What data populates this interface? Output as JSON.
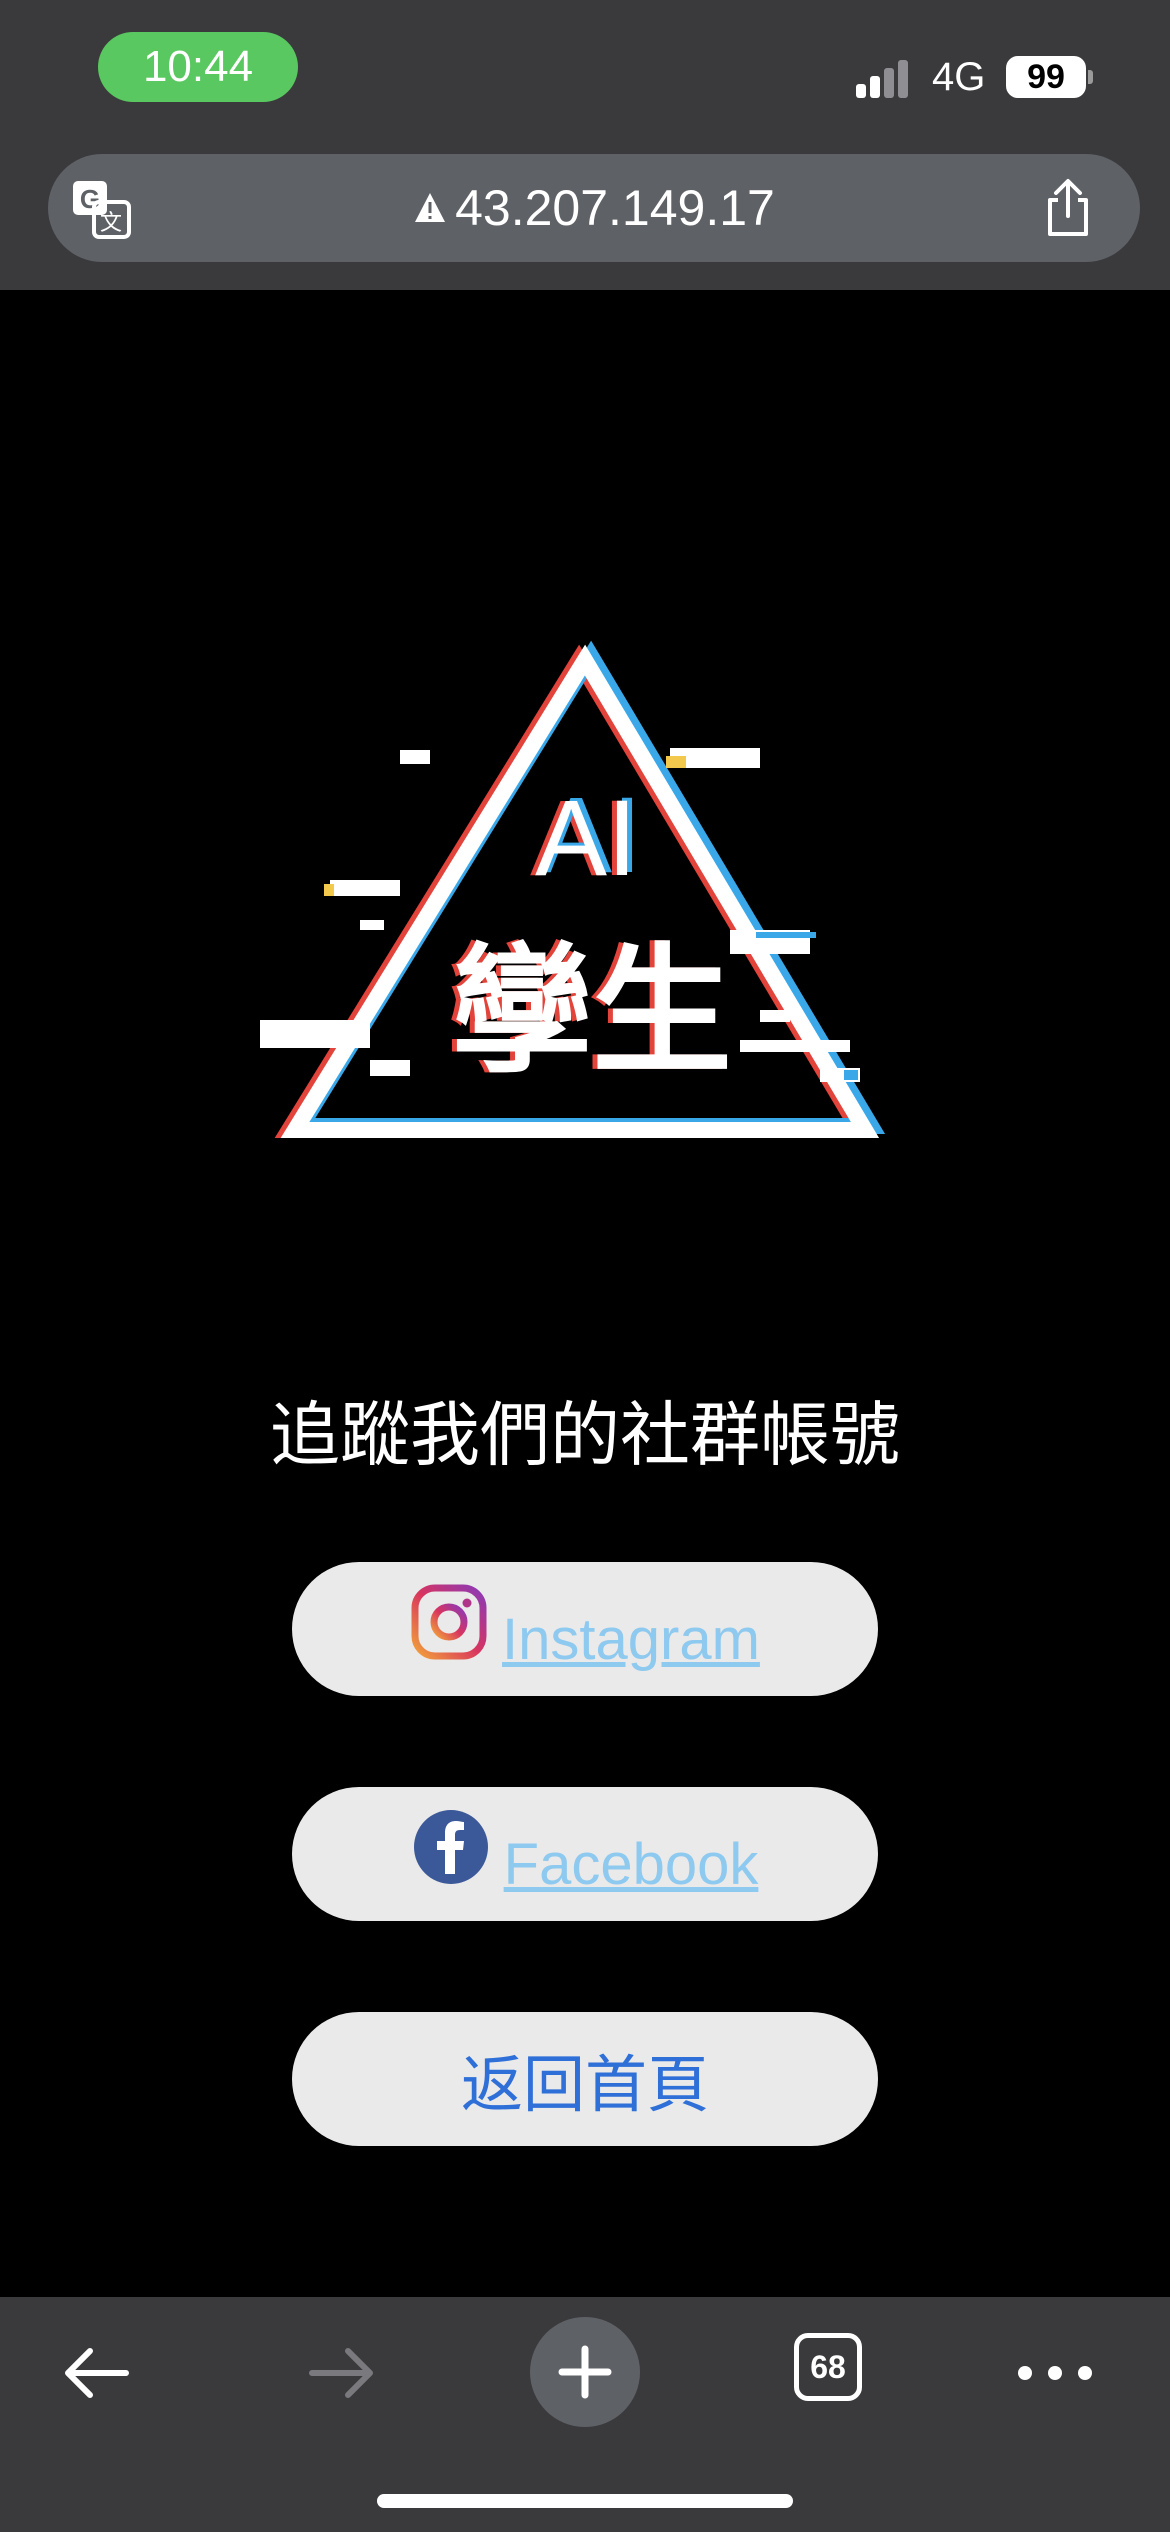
{
  "status_bar": {
    "time": "10:44",
    "network": "4G",
    "battery": "99",
    "colors": {
      "time_pill": "#5ac860",
      "background": "#3a3a3c"
    }
  },
  "address_bar": {
    "url": "43.207.149.17"
  },
  "page": {
    "heading": "追蹤我們的社群帳號",
    "logo": {
      "line1": "AI",
      "line2": "孿生"
    },
    "buttons": {
      "instagram": "Instagram",
      "facebook": "Facebook",
      "home": "返回首頁"
    },
    "colors": {
      "link": "#8ec9ef",
      "home_label": "#2f6fd8",
      "button_bg": "#eaeaea"
    }
  },
  "toolbar": {
    "tab_count": "68"
  }
}
